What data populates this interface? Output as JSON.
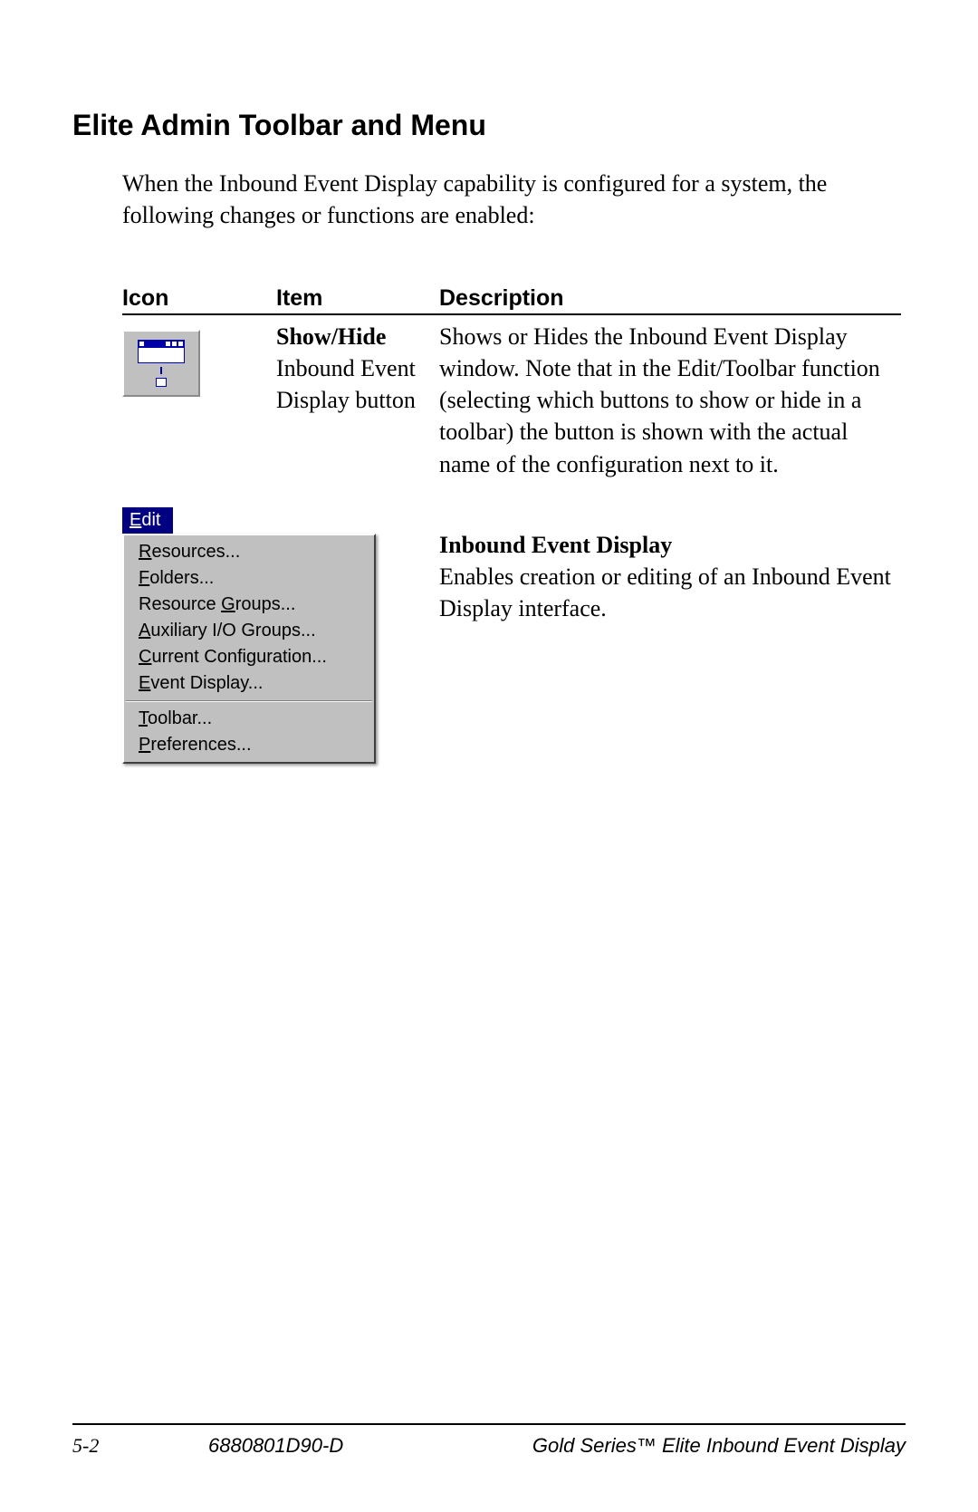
{
  "heading": "Elite Admin Toolbar and Menu",
  "intro": "When the Inbound Event Display capability is configured for a system, the following changes or functions are enabled:",
  "table": {
    "headers": {
      "icon": "Icon",
      "item": "Item",
      "desc": "Description"
    },
    "row1": {
      "item_strong": "Show/Hide",
      "item_rest": "Inbound Event Display button",
      "desc": "Shows or Hides the Inbound Event Display window.  Note that in the Edit/Toolbar function (selecting which buttons to show or hide in a toolbar) the button is shown with the actual name of the configuration next to it."
    },
    "row2": {
      "menu_title_u": "E",
      "menu_title_rest": "dit",
      "items": [
        {
          "u": "R",
          "rest": "esources..."
        },
        {
          "u": "F",
          "rest": "olders..."
        },
        {
          "pre": "Resource ",
          "u": "G",
          "rest": "roups..."
        },
        {
          "u": "A",
          "rest": "uxiliary I/O Groups..."
        },
        {
          "u": "C",
          "rest": "urrent Configuration..."
        },
        {
          "u": "E",
          "rest": "vent Display..."
        }
      ],
      "items2": [
        {
          "u": "T",
          "rest": "oolbar..."
        },
        {
          "u": "P",
          "rest": "references..."
        }
      ],
      "desc_strong": "Inbound Event Display",
      "desc_rest": "Enables creation or editing of an Inbound Event Display interface."
    }
  },
  "footer": {
    "page": "5-2",
    "docnum": "6880801D90-D",
    "title": "Gold Series™ Elite Inbound Event Display"
  }
}
